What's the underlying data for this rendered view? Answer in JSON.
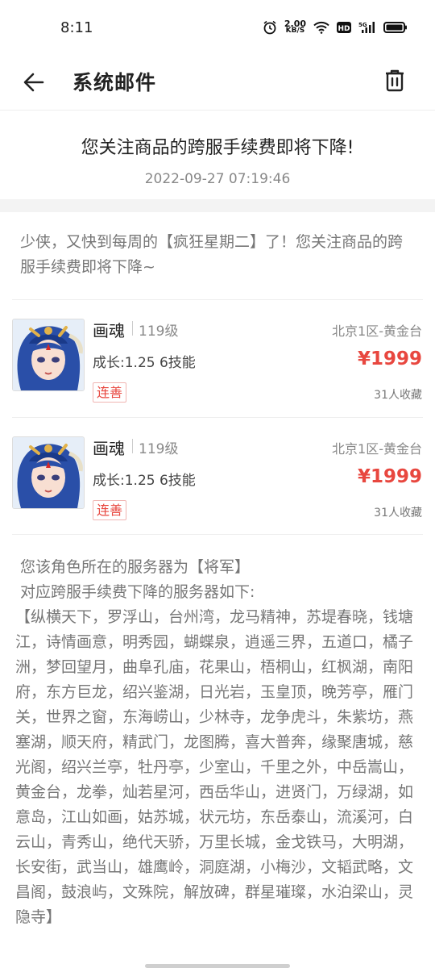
{
  "status_bar": {
    "time": "8:11",
    "net_speed_value": "2.00",
    "net_speed_unit": "KB/S",
    "icons": [
      "alarm-icon",
      "wifi-icon",
      "hd-icon",
      "signal-5g-icon",
      "battery-icon"
    ]
  },
  "header": {
    "title": "系统邮件",
    "back_icon": "arrow-left-icon",
    "delete_icon": "trash-icon"
  },
  "mail": {
    "subject": "您关注商品的跨服手续费即将下降!",
    "time": "2022-09-27 07:19:46",
    "intro": "少侠，又快到每周的【疯狂星期二】了！您关注商品的跨服手续费即将下降~"
  },
  "items": [
    {
      "name": "画魂",
      "level": "119级",
      "server": "北京1区-黄金台",
      "growth": "成长:1.25 6技能",
      "price": "¥1999",
      "tag": "连善",
      "favorites": "31人收藏"
    },
    {
      "name": "画魂",
      "level": "119级",
      "server": "北京1区-黄金台",
      "growth": "成长:1.25 6技能",
      "price": "¥1999",
      "tag": "连善",
      "favorites": "31人收藏"
    }
  ],
  "body": {
    "line1": "您该角色所在的服务器为【将军】",
    "line2": "对应跨服手续费下降的服务器如下:",
    "servers": "【纵横天下，罗浮山，台州湾，龙马精神，苏堤春晓，钱塘江，诗情画意，明秀园，蝴蝶泉，逍遥三界，五道口，橘子洲，梦回望月，曲阜孔庙，花果山，梧桐山，红枫湖，南阳府，东方巨龙，绍兴鉴湖，日光岩，玉皇顶，晚芳亭，雁门关，世界之窗，东海崂山，少林寺，龙争虎斗，朱紫坊，燕塞湖，顺天府，精武门，龙图腾，喜大普奔，缘聚唐城，慈光阁，绍兴兰亭，牡丹亭，少室山，千里之外，中岳嵩山，黄金台，龙拳，灿若星河，西岳华山，进贤门，万绿湖，如意岛，江山如画，姑苏城，状元坊，东岳泰山，流溪河，白云山，青秀山，绝代天骄，万里长城，金戈铁马，大明湖，长安街，武当山，雄鹰岭，洞庭湖，小梅沙，文韬武略，文昌阁，鼓浪屿，文殊院，解放碑，群星璀璨，水泊梁山，灵隐寺】"
  }
}
